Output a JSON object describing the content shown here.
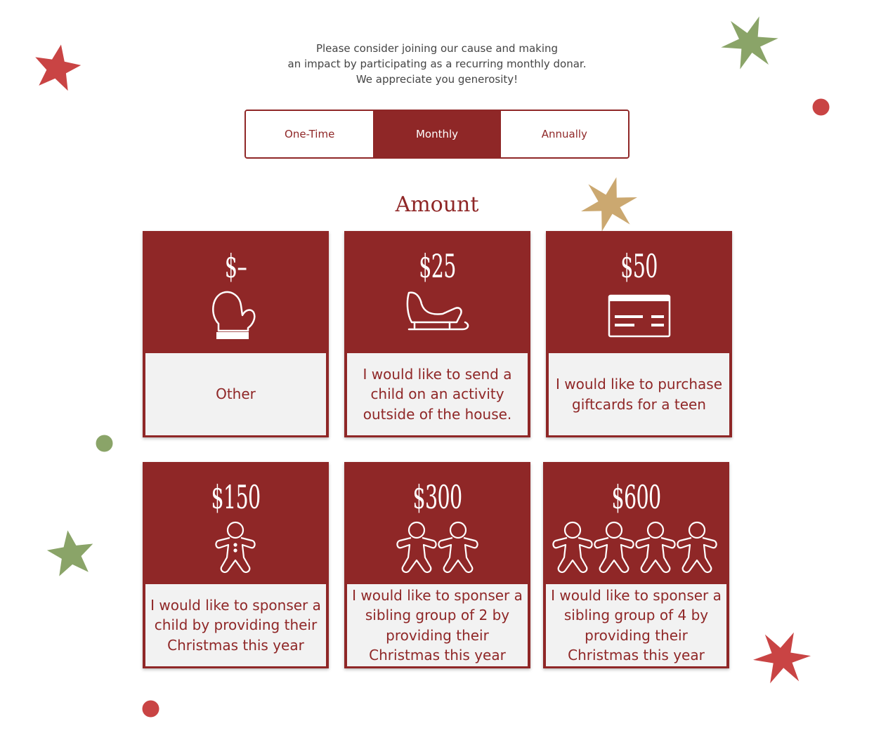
{
  "intro": {
    "line1": "Please consider joining our cause and making",
    "line2": "an impact by participating as a recurring monthly donar.",
    "line3": "We appreciate you generosity!"
  },
  "frequency": {
    "tabs": [
      "One-Time",
      "Monthly",
      "Annually"
    ],
    "selected": "Monthly"
  },
  "amount_title": "Amount",
  "cards": [
    {
      "price": "$–",
      "icon": "mitten-icon",
      "desc": "Other"
    },
    {
      "price": "$25",
      "icon": "sleigh-icon",
      "desc": "I would like to send a child on an activity outside of the house."
    },
    {
      "price": "$50",
      "icon": "gift-card-icon",
      "desc": "I would like to purchase giftcards for a teen"
    },
    {
      "price": "$150",
      "icon": "gingerbread-man-icon",
      "desc": "I would like to sponser a child by providing their Christmas this year"
    },
    {
      "price": "$300",
      "icon": "gingerbread-man-icon",
      "desc": "I would like to sponser a sibling group of 2 by providing their Christmas this year"
    },
    {
      "price": "$600",
      "icon": "gingerbread-man-icon",
      "desc": "I would like to sponser a sibling group of 4 by providing their Christmas this year"
    }
  ],
  "colors": {
    "accent": "#8f2727",
    "card_text_bg": "#f2f2f2",
    "star_red": "#c94444",
    "star_green": "#8aa468",
    "star_gold": "#cba870"
  }
}
